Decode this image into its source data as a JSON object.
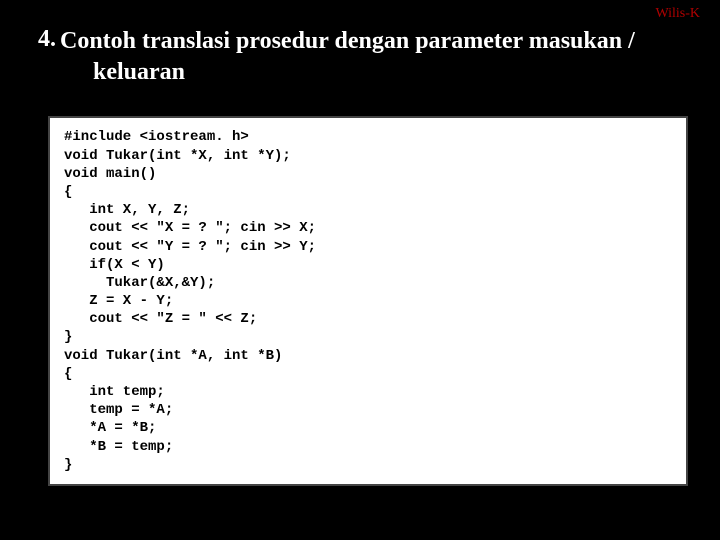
{
  "credit": "Wilis-K",
  "heading": {
    "number": "4.",
    "line1": "Contoh translasi prosedur dengan parameter masukan /",
    "line2": "keluaran"
  },
  "code": "#include <iostream. h>\nvoid Tukar(int *X, int *Y);\nvoid main()\n{\n   int X, Y, Z;\n   cout << \"X = ? \"; cin >> X;\n   cout << \"Y = ? \"; cin >> Y;\n   if(X < Y)\n     Tukar(&X,&Y);\n   Z = X - Y;\n   cout << \"Z = \" << Z;\n}\nvoid Tukar(int *A, int *B)\n{\n   int temp;\n   temp = *A;\n   *A = *B;\n   *B = temp;\n}"
}
